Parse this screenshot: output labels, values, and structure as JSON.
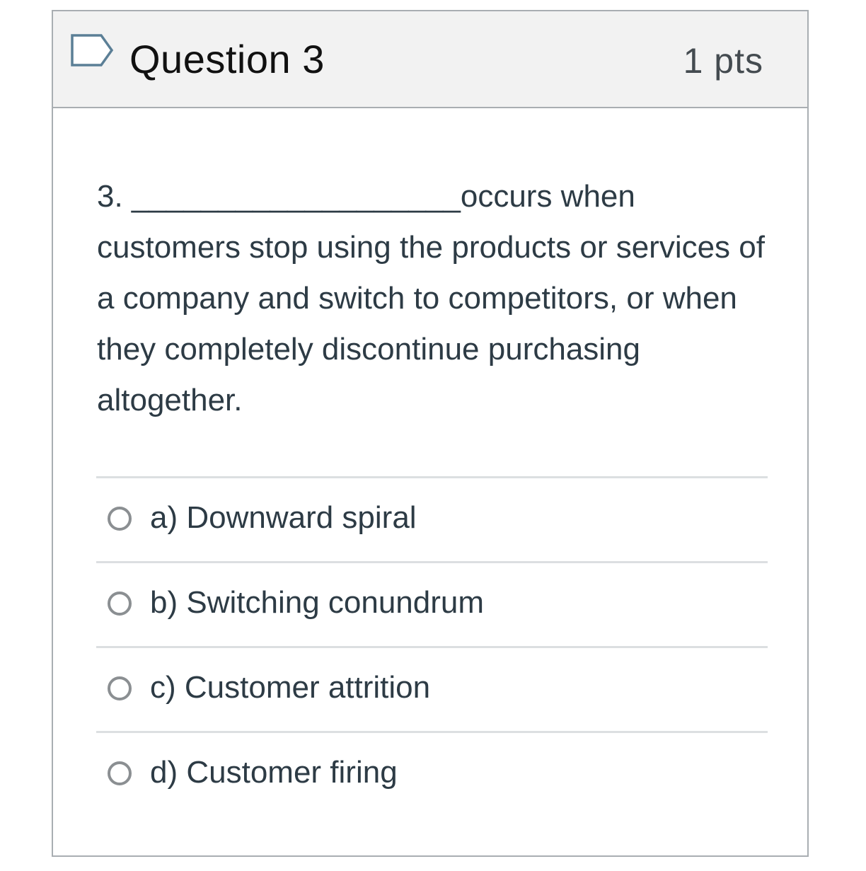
{
  "question": {
    "title": "Question 3",
    "points": "1 pts",
    "flag_icon": "flag-outline-icon",
    "text": "3. ___________________occurs when customers stop using the products or services of a company and switch to competitors, or when they completely discontinue purchasing altogether."
  },
  "answers": [
    {
      "label": "a) Downward spiral",
      "selected": false
    },
    {
      "label": "b) Switching conundrum",
      "selected": false
    },
    {
      "label": "c) Customer attrition",
      "selected": false
    },
    {
      "label": "d) Customer firing",
      "selected": false
    }
  ],
  "colors": {
    "header_bg": "#f2f2f2",
    "border": "#a9aeb2",
    "flag": "#5b7f96",
    "radio": "#8b8f92",
    "text": "#2d3b45"
  }
}
